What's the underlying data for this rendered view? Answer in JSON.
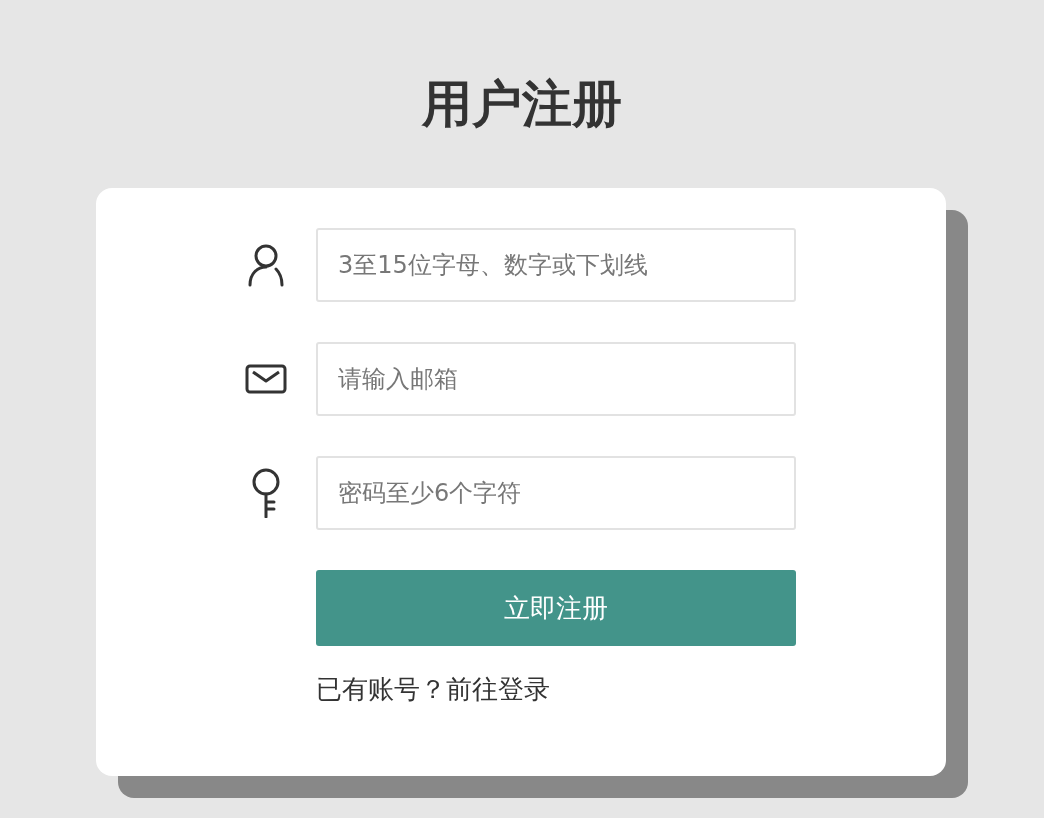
{
  "title": "用户注册",
  "fields": [
    {
      "kind": "user",
      "placeholder": "3至15位字母、数字或下划线"
    },
    {
      "kind": "email",
      "placeholder": "请输入邮箱"
    },
    {
      "kind": "key",
      "placeholder": "密码至少6个字符"
    }
  ],
  "submit_button": "立即注册",
  "login_prompt": {
    "text": "已有账号？",
    "link": "前往登录"
  }
}
